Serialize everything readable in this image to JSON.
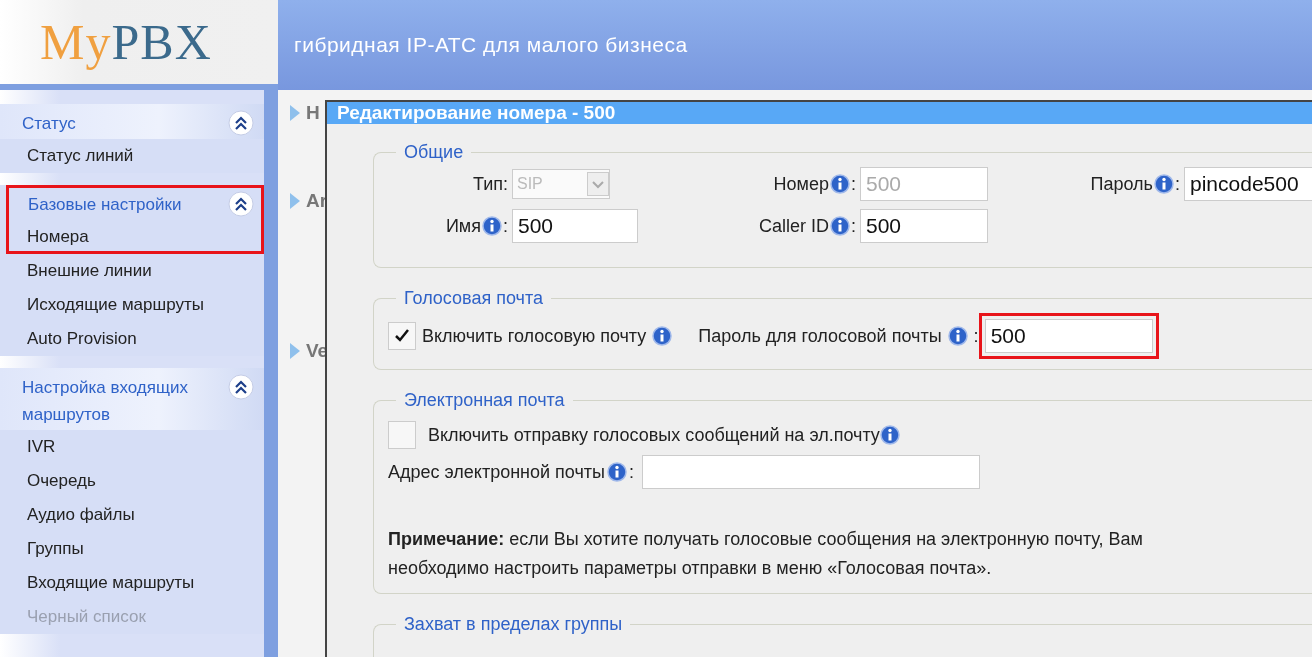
{
  "header": {
    "logo": {
      "accent": "My",
      "main": "PBX"
    },
    "tagline": "гибридная IP-АТС для малого бизнеса"
  },
  "sidebar": [
    {
      "title": "Статус",
      "expanded": true,
      "highlighted": false,
      "items": [
        {
          "label": "Статус линий",
          "highlighted": false
        }
      ]
    },
    {
      "title": "Базовые настройки",
      "expanded": true,
      "highlighted": true,
      "items": [
        {
          "label": "Номера",
          "highlighted": true
        },
        {
          "label": "Внешние линии",
          "highlighted": false
        },
        {
          "label": "Исходящие маршруты",
          "highlighted": false
        },
        {
          "label": "Auto Provision",
          "highlighted": false
        }
      ]
    },
    {
      "title": "Настройка входящих маршрутов",
      "expanded": true,
      "highlighted": false,
      "items": [
        {
          "label": "IVR",
          "highlighted": false
        },
        {
          "label": "Очередь",
          "highlighted": false
        },
        {
          "label": "Аудио файлы",
          "highlighted": false
        },
        {
          "label": "Группы",
          "highlighted": false
        },
        {
          "label": "Входящие маршруты",
          "highlighted": false
        },
        {
          "label": "Черный список",
          "highlighted": false
        }
      ]
    }
  ],
  "background_headings": [
    "Н",
    "Ar",
    "Ve"
  ],
  "dialog": {
    "title": "Редактирование номера - 500",
    "sections": [
      {
        "kind": "general",
        "legend": "Общие",
        "fields": [
          {
            "kind": "select",
            "label": "Тип:",
            "value": "SIP",
            "disabled": true
          },
          {
            "kind": "text",
            "label": "Номер",
            "info": true,
            "colon": ":",
            "value": "500",
            "disabled": true
          },
          {
            "kind": "text",
            "label": "Пароль",
            "info": true,
            "colon": ":",
            "value": "pincode500",
            "disabled": false
          },
          {
            "kind": "text",
            "label": "Имя",
            "info": true,
            "colon": ":",
            "value": "500",
            "disabled": false
          },
          {
            "kind": "text",
            "label": "Caller ID",
            "info": true,
            "colon": ":",
            "value": "500",
            "disabled": false
          }
        ]
      },
      {
        "kind": "voicemail",
        "legend": "Голосовая почта",
        "checkbox": {
          "label": "Включить голосовую почту",
          "checked": true,
          "info": true
        },
        "field": {
          "label": "Пароль для голосовой почты",
          "info": true,
          "colon": ":",
          "value": "500",
          "highlighted": true
        }
      },
      {
        "kind": "email",
        "legend": "Электронная почта",
        "checkbox": {
          "label": "Включить отправку голосовых сообщений на эл.почту",
          "checked": false,
          "info": true
        },
        "field": {
          "label": "Адрес электронной почты",
          "info": true,
          "colon": ":",
          "highlighted": false
        },
        "note": "**Примечание:** если Вы хотите получать голосовые сообщения на электронную почту, Вам необходимо настроить параметры отправки в меню «Голосовая почта»."
      },
      {
        "kind": "pickup",
        "legend": "Захват в пределах группы"
      }
    ]
  }
}
